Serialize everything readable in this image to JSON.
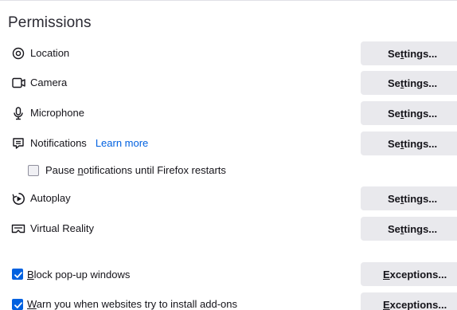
{
  "section": {
    "title": "Permissions"
  },
  "permissions": [
    {
      "id": "location",
      "label": "Location",
      "icon": "location-pin-icon",
      "button": {
        "pre": "Se",
        "key": "t",
        "post": "tings..."
      }
    },
    {
      "id": "camera",
      "label": "Camera",
      "icon": "camera-icon",
      "button": {
        "pre": "Se",
        "key": "t",
        "post": "tings..."
      }
    },
    {
      "id": "microphone",
      "label": "Microphone",
      "icon": "microphone-icon",
      "button": {
        "pre": "Se",
        "key": "t",
        "post": "tings..."
      }
    },
    {
      "id": "notifications",
      "label": "Notifications",
      "icon": "notification-icon",
      "link": "Learn more",
      "button": {
        "pre": "Se",
        "key": "t",
        "post": "tings..."
      }
    },
    {
      "id": "autoplay",
      "label": "Autoplay",
      "icon": "autoplay-icon",
      "button": {
        "pre": "Se",
        "key": "t",
        "post": "tings..."
      }
    },
    {
      "id": "virtual-reality",
      "label": "Virtual Reality",
      "icon": "vr-headset-icon",
      "button": {
        "pre": "Se",
        "key": "t",
        "post": "tings..."
      }
    }
  ],
  "pause_notifications": {
    "checked": false,
    "pre": "Pause ",
    "key": "n",
    "post": "otifications until Firefox restarts"
  },
  "block_popups": {
    "checked": true,
    "key": "B",
    "post": "lock pop-up windows",
    "button": {
      "key": "E",
      "post": "xceptions..."
    }
  },
  "warn_addons": {
    "checked": true,
    "key": "W",
    "post": "arn you when websites try to install add-ons",
    "button": {
      "key": "E",
      "post": "xceptions..."
    }
  },
  "colors": {
    "accent": "#0061e0",
    "button_bg": "#e9e9ed",
    "text": "#15141a"
  }
}
